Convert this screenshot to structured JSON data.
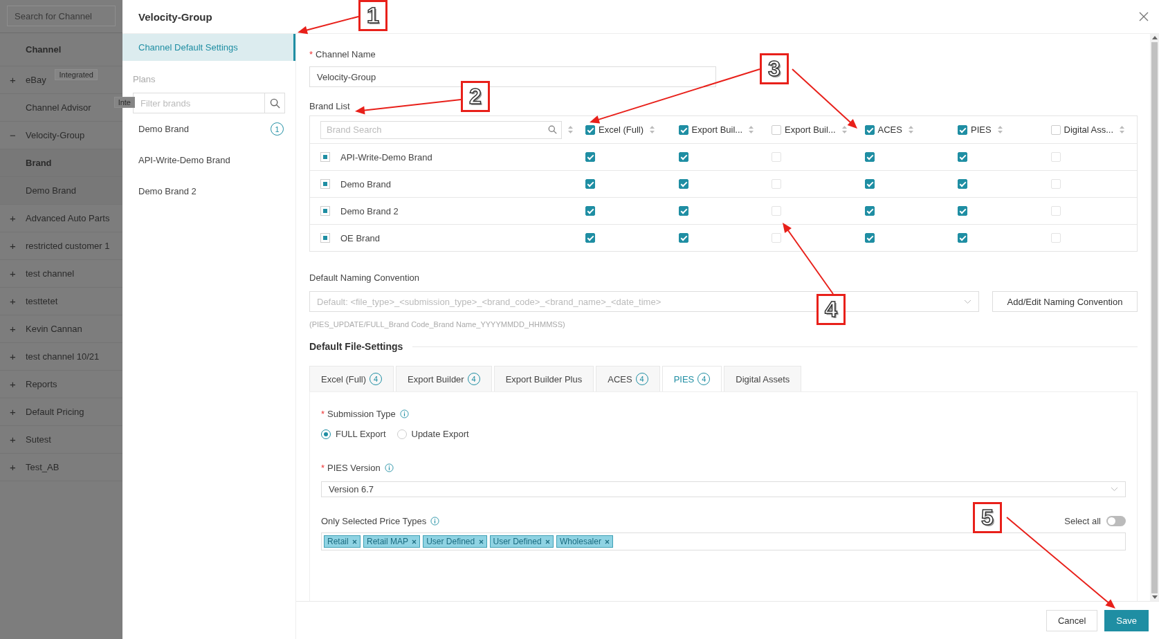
{
  "background_sidebar": {
    "search": {
      "placeholder": "Search for Channel"
    },
    "header": "Channel",
    "items": [
      {
        "label": "eBay",
        "expander": "+",
        "badge": "Integrated"
      },
      {
        "label": "Channel Advisor",
        "badge": "Inte"
      },
      {
        "label": "Velocity-Group",
        "expander": "−",
        "children_header": "Brand",
        "children": [
          {
            "label": "Demo Brand"
          }
        ]
      },
      {
        "label": "Advanced Auto Parts",
        "expander": "+"
      },
      {
        "label": "restricted customer 1",
        "expander": "+"
      },
      {
        "label": "test channel",
        "expander": "+"
      },
      {
        "label": "testtetet",
        "expander": "+"
      },
      {
        "label": "Kevin Cannan",
        "expander": "+"
      },
      {
        "label": "test channel 10/21",
        "expander": "+"
      },
      {
        "label": "Reports",
        "expander": "+"
      },
      {
        "label": "Default Pricing",
        "expander": "+"
      },
      {
        "label": "Sutest",
        "expander": "+"
      },
      {
        "label": "Test_AB",
        "expander": "+"
      }
    ]
  },
  "modal": {
    "title": "Velocity-Group",
    "nav": {
      "items": [
        {
          "label": "Channel Default Settings",
          "selected": true
        }
      ],
      "plans_label": "Plans",
      "filter": {
        "placeholder": "Filter brands"
      },
      "brands": [
        {
          "label": "Demo Brand",
          "count": "1"
        },
        {
          "label": "API-Write-Demo Brand"
        },
        {
          "label": "Demo Brand 2"
        }
      ]
    },
    "channel_name": {
      "label": "Channel Name",
      "required_mark": "*",
      "value": "Velocity-Group"
    },
    "brand_list": {
      "label": "Brand List",
      "search_placeholder": "Brand Search",
      "columns": [
        {
          "label": "Excel (Full)",
          "checked": true
        },
        {
          "label": "Export Buil...",
          "checked": true
        },
        {
          "label": "Export Buil...",
          "checked": false
        },
        {
          "label": "ACES",
          "checked": true
        },
        {
          "label": "PIES",
          "checked": true
        },
        {
          "label": "Digital Ass...",
          "checked": false
        }
      ],
      "rows": [
        {
          "name": "API-Write-Demo Brand",
          "selected": true,
          "checks": [
            true,
            true,
            false,
            true,
            true,
            false
          ]
        },
        {
          "name": "Demo Brand",
          "selected": true,
          "checks": [
            true,
            true,
            false,
            true,
            true,
            false
          ]
        },
        {
          "name": "Demo Brand 2",
          "selected": true,
          "checks": [
            true,
            true,
            false,
            true,
            true,
            false
          ]
        },
        {
          "name": "OE Brand",
          "selected": true,
          "checks": [
            true,
            true,
            false,
            true,
            true,
            false
          ]
        }
      ]
    },
    "naming": {
      "label": "Default Naming Convention",
      "placeholder": "Default: <file_type>_<submission_type>_<brand_code>_<brand_name>_<date_time>",
      "hint": "(PIES_UPDATE/FULL_Brand Code_Brand Name_YYYYMMDD_HHMMSS)",
      "button": "Add/Edit Naming Convention"
    },
    "file_settings": {
      "title": "Default File-Settings",
      "tabs": [
        {
          "label": "Excel (Full)",
          "count": "4",
          "selected": false
        },
        {
          "label": "Export Builder",
          "count": "4",
          "selected": false
        },
        {
          "label": "Export Builder Plus",
          "selected": false
        },
        {
          "label": "ACES",
          "count": "4",
          "selected": false
        },
        {
          "label": "PIES",
          "count": "4",
          "selected": true
        },
        {
          "label": "Digital Assets",
          "selected": false
        }
      ],
      "submission_type": {
        "label": "Submission Type",
        "required_mark": "*",
        "options": [
          {
            "label": "FULL Export",
            "selected": true
          },
          {
            "label": "Update Export",
            "selected": false
          }
        ]
      },
      "pies_version": {
        "label": "PIES Version",
        "required_mark": "*",
        "value": "Version 6.7"
      },
      "price_types": {
        "label": "Only Selected Price Types",
        "select_all_label": "Select all",
        "select_all_on": false,
        "tags": [
          "Retail",
          "Retail MAP",
          "User Defined",
          "User Defined",
          "Wholesaler"
        ]
      }
    },
    "footer_buttons": [
      {
        "label": "Cancel",
        "kind": "default"
      },
      {
        "label": "Save",
        "kind": "primary"
      }
    ]
  },
  "callouts": [
    {
      "number": "1"
    },
    {
      "number": "2"
    },
    {
      "number": "3"
    },
    {
      "number": "4"
    },
    {
      "number": "5"
    }
  ]
}
